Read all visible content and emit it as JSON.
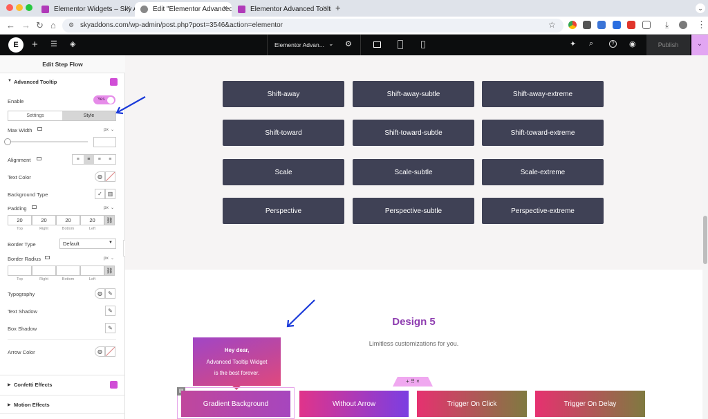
{
  "browser": {
    "tabs": [
      {
        "title": "Elementor Widgets – Sky Ad..."
      },
      {
        "title": "Edit \"Elementor Advanced To"
      },
      {
        "title": "Elementor Advanced Tooltip"
      }
    ],
    "url": "skyaddons.com/wp-admin/post.php?post=3546&action=elementor"
  },
  "topbar": {
    "doc_title": "Elementor Advan...",
    "publish_label": "Publish"
  },
  "panel": {
    "title": "Edit Step Flow",
    "section_title": "Advanced Tooltip",
    "enable_label": "Enable",
    "enable_value": "Yes",
    "tab_settings": "Settings",
    "tab_style": "Style",
    "max_width_label": "Max Width",
    "unit_px": "px",
    "alignment_label": "Alignment",
    "text_color_label": "Text Color",
    "background_type_label": "Background Type",
    "padding_label": "Padding",
    "padding_values": [
      "20",
      "20",
      "20",
      "20"
    ],
    "sides": [
      "Top",
      "Right",
      "Bottom",
      "Left"
    ],
    "border_type_label": "Border Type",
    "border_type_value": "Default",
    "border_radius_label": "Border Radius",
    "typography_label": "Typography",
    "text_shadow_label": "Text Shadow",
    "box_shadow_label": "Box Shadow",
    "arrow_color_label": "Arrow Color",
    "confetti_label": "Confetti Effects",
    "motion_label": "Motion Effects"
  },
  "grid_buttons": [
    "Shift-away",
    "Shift-away-subtle",
    "Shift-away-extreme",
    "Shift-toward",
    "Shift-toward-subtle",
    "Shift-toward-extreme",
    "Scale",
    "Scale-subtle",
    "Scale-extreme",
    "Perspective",
    "Perspective-subtle",
    "Perspective-extreme"
  ],
  "design": {
    "title": "Design 5",
    "subtitle": "Limitless customizations for you."
  },
  "tooltip": {
    "line1": "Hey dear,",
    "line2": "Advanced Tooltip Widget",
    "line3": "is the best forever."
  },
  "bottom_buttons": [
    "Gradient Background",
    "Without Arrow",
    "Trigger On Click",
    "Trigger On Delay"
  ],
  "colors": {
    "accent": "#d04ed6",
    "grid_button": "#3f4155",
    "design_title": "#8e3db0",
    "arrow": "#1a3ad9"
  }
}
